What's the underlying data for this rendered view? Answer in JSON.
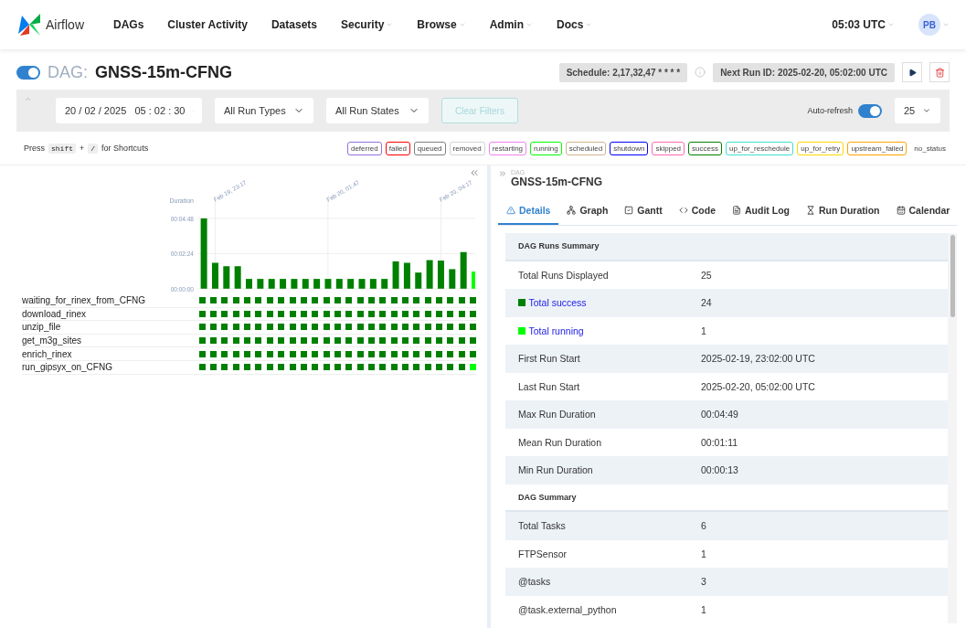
{
  "nav": {
    "brand": "Airflow",
    "items": [
      {
        "label": "DAGs",
        "dropdown": false
      },
      {
        "label": "Cluster Activity",
        "dropdown": false
      },
      {
        "label": "Datasets",
        "dropdown": false
      },
      {
        "label": "Security",
        "dropdown": true
      },
      {
        "label": "Browse",
        "dropdown": true
      },
      {
        "label": "Admin",
        "dropdown": true
      },
      {
        "label": "Docs",
        "dropdown": true
      }
    ],
    "time": "05:03 UTC",
    "user": "PB"
  },
  "dag_header": {
    "prefix": "DAG:",
    "name": "GNSS-15m-CFNG",
    "on": true,
    "schedule": "Schedule: 2,17,32,47 * * * *",
    "next_run": "Next Run ID: 2025-02-20, 05:02:00 UTC"
  },
  "filters": {
    "base_date": "20 / 02 / 2025   05 : 02 : 30",
    "run_type": "All Run Types",
    "run_state": "All Run States",
    "clear": "Clear Filters",
    "clear_disabled": true,
    "auto_refresh_label": "Auto-refresh",
    "auto_refresh": true,
    "page_size": "25"
  },
  "shortcuts": {
    "press": "Press",
    "key1": "shift",
    "plus": "+",
    "key2": "/",
    "suffix": "for Shortcuts"
  },
  "legend": [
    {
      "label": "deferred",
      "color": "#9370db"
    },
    {
      "label": "failed",
      "color": "#ff0000"
    },
    {
      "label": "queued",
      "color": "#808080"
    },
    {
      "label": "removed",
      "color": "#d3d3d3"
    },
    {
      "label": "restarting",
      "color": "#ee82ee"
    },
    {
      "label": "running",
      "color": "#00ff00"
    },
    {
      "label": "scheduled",
      "color": "#d2b48c"
    },
    {
      "label": "shutdown",
      "color": "#0000ff"
    },
    {
      "label": "skipped",
      "color": "#ff69b4"
    },
    {
      "label": "success",
      "color": "#008000"
    },
    {
      "label": "up_for_reschedule",
      "color": "#40e0d0"
    },
    {
      "label": "up_for_retry",
      "color": "#ffd700"
    },
    {
      "label": "upstream_failed",
      "color": "#ffa500"
    },
    {
      "label": "no_status"
    }
  ],
  "grid": {
    "date_labels": [
      "Feb 19, 23:17",
      "Feb 20, 01:47",
      "Feb 20, 04:17"
    ],
    "chart_data": {
      "type": "bar",
      "ylabel": "Duration",
      "stacked": true,
      "grid": true,
      "series": [
        {
          "color": "#008000",
          "values": [
            288,
            106,
            92,
            92,
            40,
            40,
            40,
            40,
            40,
            40,
            40,
            40,
            40,
            40,
            40,
            40,
            40,
            112,
            106,
            66,
            117,
            115,
            80,
            150,
            null
          ]
        },
        {
          "color": "#00ff00",
          "values": [
            null,
            null,
            null,
            null,
            null,
            null,
            null,
            null,
            null,
            null,
            null,
            null,
            null,
            null,
            null,
            null,
            null,
            null,
            null,
            null,
            null,
            null,
            null,
            null,
            70
          ]
        }
      ],
      "ylim": [
        0,
        288
      ],
      "yticks": [
        {
          "value": 0,
          "label": "00:00:00"
        },
        {
          "value": 144,
          "label": "00:02:24"
        },
        {
          "value": 288,
          "label": "00:04:48"
        }
      ]
    },
    "tasks": [
      {
        "name": "waiting_for_rinex_from_CFNG",
        "cells": [
          {
            "color": "#008000"
          },
          {
            "color": "#008000"
          },
          {
            "color": "#008000"
          },
          {
            "color": "#008000"
          },
          {
            "color": "#008000"
          },
          {
            "color": "#008000"
          },
          {
            "color": "#008000"
          },
          {
            "color": "#008000"
          },
          {
            "color": "#008000"
          },
          {
            "color": "#008000"
          },
          {
            "color": "#008000"
          },
          {
            "color": "#008000"
          },
          {
            "color": "#008000"
          },
          {
            "color": "#008000"
          },
          {
            "color": "#008000"
          },
          {
            "color": "#008000"
          },
          {
            "color": "#008000"
          },
          {
            "color": "#008000"
          },
          {
            "color": "#008000"
          },
          {
            "color": "#008000"
          },
          {
            "color": "#008000"
          },
          {
            "color": "#008000"
          },
          {
            "color": "#008000"
          },
          {
            "color": "#008000"
          },
          {
            "color": "#008000"
          }
        ]
      },
      {
        "name": "download_rinex",
        "cells": [
          {
            "color": "#008000"
          },
          {
            "color": "#008000"
          },
          {
            "color": "#008000"
          },
          {
            "color": "#008000"
          },
          {
            "color": "#008000"
          },
          {
            "color": "#008000"
          },
          {
            "color": "#008000"
          },
          {
            "color": "#008000"
          },
          {
            "color": "#008000"
          },
          {
            "color": "#008000"
          },
          {
            "color": "#008000"
          },
          {
            "color": "#008000"
          },
          {
            "color": "#008000"
          },
          {
            "color": "#008000"
          },
          {
            "color": "#008000"
          },
          {
            "color": "#008000"
          },
          {
            "color": "#008000"
          },
          {
            "color": "#008000"
          },
          {
            "color": "#008000"
          },
          {
            "color": "#008000"
          },
          {
            "color": "#008000"
          },
          {
            "color": "#008000"
          },
          {
            "color": "#008000"
          },
          {
            "color": "#008000"
          },
          {
            "color": "#008000"
          }
        ]
      },
      {
        "name": "unzip_file",
        "cells": [
          {
            "color": "#008000"
          },
          {
            "color": "#008000"
          },
          {
            "color": "#008000"
          },
          {
            "color": "#008000"
          },
          {
            "color": "#008000"
          },
          {
            "color": "#008000"
          },
          {
            "color": "#008000"
          },
          {
            "color": "#008000"
          },
          {
            "color": "#008000"
          },
          {
            "color": "#008000"
          },
          {
            "color": "#008000"
          },
          {
            "color": "#008000"
          },
          {
            "color": "#008000"
          },
          {
            "color": "#008000"
          },
          {
            "color": "#008000"
          },
          {
            "color": "#008000"
          },
          {
            "color": "#008000"
          },
          {
            "color": "#008000"
          },
          {
            "color": "#008000"
          },
          {
            "color": "#008000"
          },
          {
            "color": "#008000"
          },
          {
            "color": "#008000"
          },
          {
            "color": "#008000"
          },
          {
            "color": "#008000"
          },
          {
            "color": "#008000"
          }
        ]
      },
      {
        "name": "get_m3g_sites",
        "cells": [
          {
            "color": "#008000"
          },
          {
            "color": "#008000"
          },
          {
            "color": "#008000"
          },
          {
            "color": "#008000"
          },
          {
            "color": "#008000"
          },
          {
            "color": "#008000"
          },
          {
            "color": "#008000"
          },
          {
            "color": "#008000"
          },
          {
            "color": "#008000"
          },
          {
            "color": "#008000"
          },
          {
            "color": "#008000"
          },
          {
            "color": "#008000"
          },
          {
            "color": "#008000"
          },
          {
            "color": "#008000"
          },
          {
            "color": "#008000"
          },
          {
            "color": "#008000"
          },
          {
            "color": "#008000"
          },
          {
            "color": "#008000"
          },
          {
            "color": "#008000"
          },
          {
            "color": "#008000"
          },
          {
            "color": "#008000"
          },
          {
            "color": "#008000"
          },
          {
            "color": "#008000"
          },
          {
            "color": "#008000"
          },
          {
            "color": "#008000"
          }
        ]
      },
      {
        "name": "enrich_rinex",
        "cells": [
          {
            "color": "#008000"
          },
          {
            "color": "#008000"
          },
          {
            "color": "#008000"
          },
          {
            "color": "#008000"
          },
          {
            "color": "#008000"
          },
          {
            "color": "#008000"
          },
          {
            "color": "#008000"
          },
          {
            "color": "#008000"
          },
          {
            "color": "#008000"
          },
          {
            "color": "#008000"
          },
          {
            "color": "#008000"
          },
          {
            "color": "#008000"
          },
          {
            "color": "#008000"
          },
          {
            "color": "#008000"
          },
          {
            "color": "#008000"
          },
          {
            "color": "#008000"
          },
          {
            "color": "#008000"
          },
          {
            "color": "#008000"
          },
          {
            "color": "#008000"
          },
          {
            "color": "#008000"
          },
          {
            "color": "#008000"
          },
          {
            "color": "#008000"
          },
          {
            "color": "#008000"
          },
          {
            "color": "#008000"
          },
          {
            "color": "#008000"
          }
        ]
      },
      {
        "name": "run_gipsyx_on_CFNG",
        "cells": [
          {
            "color": "#008000"
          },
          {
            "color": "#008000"
          },
          {
            "color": "#008000"
          },
          {
            "color": "#008000"
          },
          {
            "color": "#008000"
          },
          {
            "color": "#008000"
          },
          {
            "color": "#008000"
          },
          {
            "color": "#008000"
          },
          {
            "color": "#008000"
          },
          {
            "color": "#008000"
          },
          {
            "color": "#008000"
          },
          {
            "color": "#008000"
          },
          {
            "color": "#008000"
          },
          {
            "color": "#008000"
          },
          {
            "color": "#008000"
          },
          {
            "color": "#008000"
          },
          {
            "color": "#008000"
          },
          {
            "color": "#008000"
          },
          {
            "color": "#008000"
          },
          {
            "color": "#008000"
          },
          {
            "color": "#008000"
          },
          {
            "color": "#008000"
          },
          {
            "color": "#008000"
          },
          {
            "color": "#008000"
          },
          {
            "color": "#00ff00"
          }
        ]
      }
    ]
  },
  "details": {
    "dag_label": "DAG",
    "dag_name": "GNSS-15m-CFNG",
    "tabs": [
      {
        "label": "Details",
        "selected": true
      },
      {
        "label": "Graph",
        "selected": false
      },
      {
        "label": "Gantt",
        "selected": false
      },
      {
        "label": "Code",
        "selected": false
      },
      {
        "label": "Audit Log",
        "selected": false
      },
      {
        "label": "Run Duration",
        "selected": false
      },
      {
        "label": "Calendar",
        "selected": false
      }
    ],
    "rows": [
      {
        "kind": "section",
        "label": "DAG Runs Summary"
      },
      {
        "kind": "plain",
        "label": "Total Runs Displayed",
        "value": "25"
      },
      {
        "kind": "status",
        "label": "Total success",
        "value": "24",
        "color": "#008000"
      },
      {
        "kind": "status",
        "label": "Total running",
        "value": "1",
        "color": "#00ff00"
      },
      {
        "kind": "plain",
        "label": "First Run Start",
        "value": "2025-02-19, 23:02:00 UTC"
      },
      {
        "kind": "plain",
        "label": "Last Run Start",
        "value": "2025-02-20, 05:02:00 UTC"
      },
      {
        "kind": "plain",
        "label": "Max Run Duration",
        "value": "00:04:49"
      },
      {
        "kind": "plain",
        "label": "Mean Run Duration",
        "value": "00:01:11"
      },
      {
        "kind": "plain",
        "label": "Min Run Duration",
        "value": "00:00:13"
      },
      {
        "kind": "section",
        "label": "DAG Summary"
      },
      {
        "kind": "plain",
        "label": "Total Tasks",
        "value": "6"
      },
      {
        "kind": "plain",
        "label": "FTPSensor",
        "value": "1"
      },
      {
        "kind": "plain",
        "label": "@tasks",
        "value": "3"
      },
      {
        "kind": "plain",
        "label": "@task.external_python",
        "value": "1"
      }
    ]
  }
}
